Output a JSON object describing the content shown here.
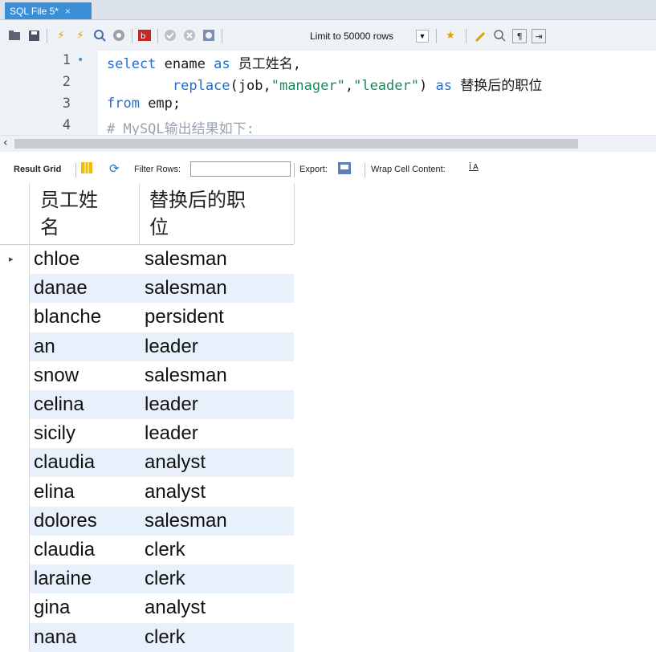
{
  "tab": {
    "title": "SQL File 5*",
    "close": "×"
  },
  "toolbar": {
    "icons": [
      "folder-icon",
      "save-icon",
      "lightning-icon",
      "lightning-cursor-icon",
      "magnifier-icon",
      "stop-icon",
      "toggle-icon",
      "commit-icon",
      "rollback-icon",
      "autocommit-icon",
      "beautify-icon",
      "bookmark-icon",
      "find-icon",
      "invisible-chars-icon",
      "wrap-icon"
    ],
    "limit_label": "Limit to 50000 rows"
  },
  "editor": {
    "line_numbers": [
      "1",
      "2",
      "3",
      "4"
    ],
    "active_line_marker": "•",
    "lines": [
      [
        {
          "t": "select",
          "c": "kw"
        },
        {
          "t": " ename ",
          "c": ""
        },
        {
          "t": "as",
          "c": "kw"
        },
        {
          "t": " 员工姓名,",
          "c": ""
        }
      ],
      [
        {
          "t": "        replace",
          "c": "kw"
        },
        {
          "t": "(job,",
          "c": ""
        },
        {
          "t": "\"manager\"",
          "c": "str"
        },
        {
          "t": ",",
          "c": ""
        },
        {
          "t": "\"leader\"",
          "c": "str"
        },
        {
          "t": ") ",
          "c": ""
        },
        {
          "t": "as",
          "c": "kw"
        },
        {
          "t": " 替换后的职位",
          "c": ""
        }
      ],
      [
        {
          "t": "from",
          "c": "kw"
        },
        {
          "t": " emp;",
          "c": ""
        }
      ],
      [
        {
          "t": "# MySQL输出结果如下:",
          "c": "cmt"
        }
      ]
    ]
  },
  "results_toolbar": {
    "result_grid": "Result Grid",
    "filter_rows": "Filter Rows:",
    "filter_value": "",
    "export": "Export:",
    "wrap_cell": "Wrap Cell Content:"
  },
  "grid": {
    "columns": [
      "员工姓名",
      "替换后的职位"
    ],
    "current_row_marker": "▸",
    "rows": [
      [
        "chloe",
        "salesman"
      ],
      [
        "danae",
        "salesman"
      ],
      [
        "blanche",
        "persident"
      ],
      [
        "an",
        "leader"
      ],
      [
        "snow",
        "salesman"
      ],
      [
        "celina",
        "leader"
      ],
      [
        "sicily",
        "leader"
      ],
      [
        "claudia",
        "analyst"
      ],
      [
        "elina",
        "analyst"
      ],
      [
        "dolores",
        "salesman"
      ],
      [
        "claudia",
        "clerk"
      ],
      [
        "laraine",
        "clerk"
      ],
      [
        "gina",
        "analyst"
      ],
      [
        "nana",
        "clerk"
      ]
    ]
  },
  "colors": {
    "tab": "#3b8fd6",
    "keyword": "#1e6fd0",
    "string": "#1c8a5a",
    "comment": "#9aa3ad",
    "alt_row": "#e8f0fb"
  }
}
